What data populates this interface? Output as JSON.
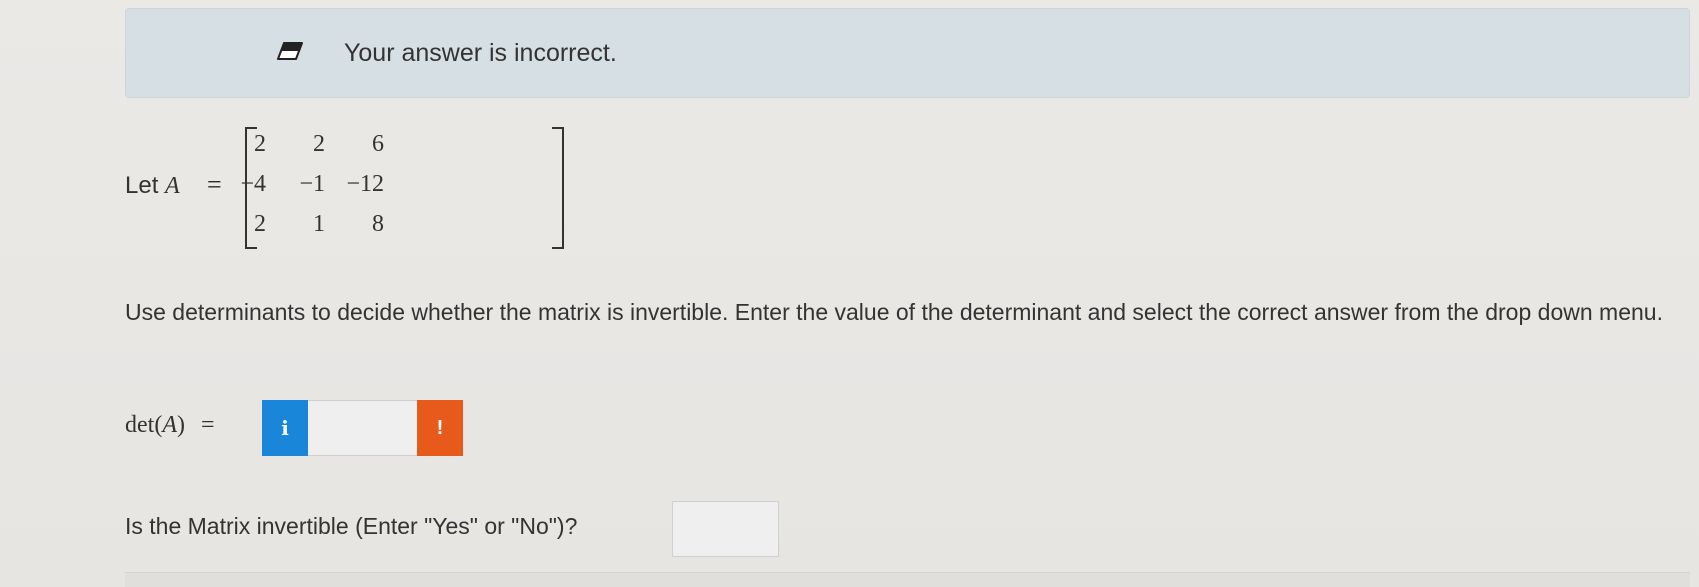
{
  "feedback": {
    "message": "Your answer is incorrect.",
    "icon": "eraser-icon"
  },
  "problem": {
    "let_prefix": "Let",
    "matrix_var": "A",
    "equals": "=",
    "matrix": [
      [
        "2",
        "2",
        "6"
      ],
      [
        "−4",
        "−1",
        "−12"
      ],
      [
        "2",
        "1",
        "8"
      ]
    ],
    "instructions": "Use determinants to decide whether the matrix is invertible. Enter the value of the determinant and select the correct answer from the drop down menu."
  },
  "det_field": {
    "label_fn": "det(",
    "label_var": "A",
    "label_close": ")",
    "equals": "=",
    "value": "",
    "info_glyph": "i",
    "warn_glyph": "!"
  },
  "invertible_field": {
    "label": "Is the Matrix invertible (Enter \"Yes\" or \"No\")?",
    "value": ""
  },
  "colors": {
    "feedback_bg": "#d6e0e4",
    "info_blue": "#1a86d9",
    "warn_orange": "#e8591c"
  }
}
